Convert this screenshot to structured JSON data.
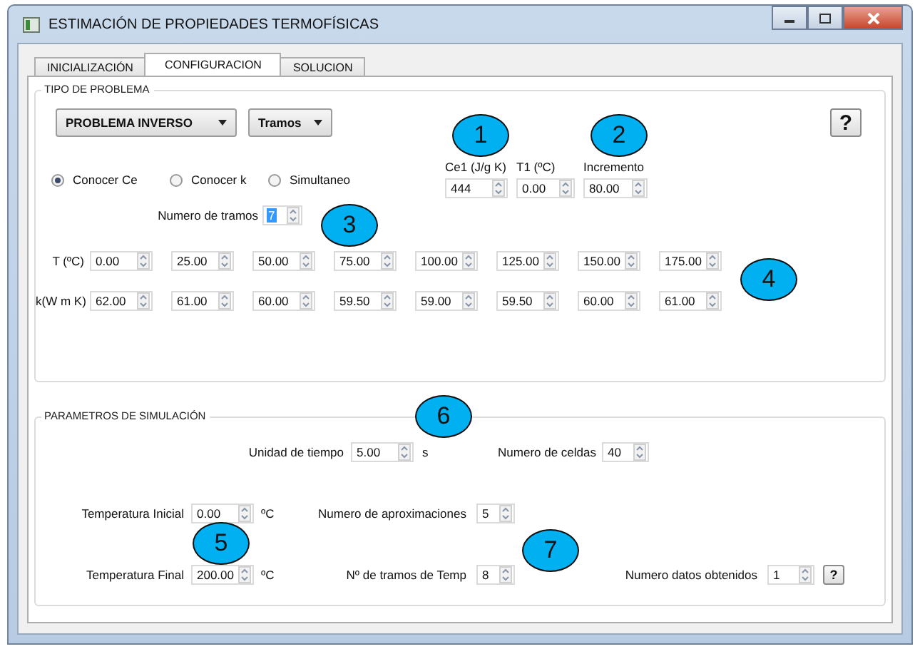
{
  "window": {
    "title": "ESTIMACIÓN DE PROPIEDADES TERMOFÍSICAS"
  },
  "tabs": [
    {
      "label": "INICIALIZACIÓN",
      "selected": false
    },
    {
      "label": "CONFIGURACION",
      "selected": true
    },
    {
      "label": "SOLUCION",
      "selected": false
    }
  ],
  "tipo_de_problema": {
    "title": "TIPO DE PROBLEMA",
    "problem_dropdown": "PROBLEMA INVERSO",
    "mode_dropdown": "Tramos",
    "help": "?",
    "radios": [
      {
        "label": "Conocer Ce",
        "selected": true
      },
      {
        "label": "Conocer k",
        "selected": false
      },
      {
        "label": "Simultaneo",
        "selected": false
      }
    ],
    "fields": [
      {
        "label": "Ce1 (J/g K)",
        "value": "444"
      },
      {
        "label": "T1 (ºC)",
        "value": "0.00"
      },
      {
        "label": "Incremento",
        "value": "80.00"
      }
    ],
    "numero_de_tramos": {
      "label": "Numero de tramos",
      "value": "7",
      "text_selected": true
    },
    "rows": [
      {
        "label": "T (ºC)",
        "values": [
          "0.00",
          "25.00",
          "50.00",
          "75.00",
          "100.00",
          "125.00",
          "150.00",
          "175.00"
        ]
      },
      {
        "label": "k(W m K)",
        "values": [
          "62.00",
          "61.00",
          "60.00",
          "59.50",
          "59.00",
          "59.50",
          "60.00",
          "61.00"
        ]
      }
    ]
  },
  "parametros_de_simulacion": {
    "title": "PARAMETROS DE SIMULACIÓN",
    "unidad_de_tiempo": {
      "label": "Unidad de tiempo",
      "value": "5.00",
      "unit": "s"
    },
    "numero_de_celdas": {
      "label": "Numero de celdas",
      "value": "40"
    },
    "temperatura_inicial": {
      "label": "Temperatura Inicial",
      "value": "0.00",
      "unit": "ºC"
    },
    "numero_de_aproximaciones": {
      "label": "Numero de aproximaciones",
      "value": "5"
    },
    "temperatura_final": {
      "label": "Temperatura Final",
      "value": "200.00",
      "unit": "ºC"
    },
    "tramos_de_temp": {
      "label": "Nº de tramos de Temp",
      "value": "8"
    },
    "numero_datos_obtenidos": {
      "label": "Numero datos obtenidos",
      "value": "1"
    },
    "help": "?"
  },
  "callouts": [
    "1",
    "2",
    "3",
    "4",
    "5",
    "6",
    "7"
  ]
}
